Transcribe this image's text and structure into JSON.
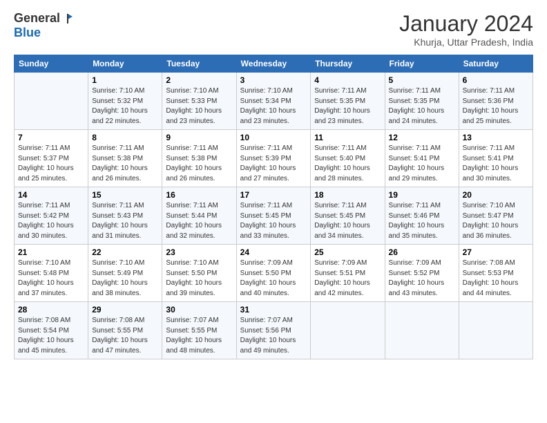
{
  "header": {
    "logo_general": "General",
    "logo_blue": "Blue",
    "title": "January 2024",
    "location": "Khurja, Uttar Pradesh, India"
  },
  "days_of_week": [
    "Sunday",
    "Monday",
    "Tuesday",
    "Wednesday",
    "Thursday",
    "Friday",
    "Saturday"
  ],
  "weeks": [
    [
      {
        "day": "",
        "info": ""
      },
      {
        "day": "1",
        "info": "Sunrise: 7:10 AM\nSunset: 5:32 PM\nDaylight: 10 hours\nand 22 minutes."
      },
      {
        "day": "2",
        "info": "Sunrise: 7:10 AM\nSunset: 5:33 PM\nDaylight: 10 hours\nand 23 minutes."
      },
      {
        "day": "3",
        "info": "Sunrise: 7:10 AM\nSunset: 5:34 PM\nDaylight: 10 hours\nand 23 minutes."
      },
      {
        "day": "4",
        "info": "Sunrise: 7:11 AM\nSunset: 5:35 PM\nDaylight: 10 hours\nand 23 minutes."
      },
      {
        "day": "5",
        "info": "Sunrise: 7:11 AM\nSunset: 5:35 PM\nDaylight: 10 hours\nand 24 minutes."
      },
      {
        "day": "6",
        "info": "Sunrise: 7:11 AM\nSunset: 5:36 PM\nDaylight: 10 hours\nand 25 minutes."
      }
    ],
    [
      {
        "day": "7",
        "info": "Sunrise: 7:11 AM\nSunset: 5:37 PM\nDaylight: 10 hours\nand 25 minutes."
      },
      {
        "day": "8",
        "info": "Sunrise: 7:11 AM\nSunset: 5:38 PM\nDaylight: 10 hours\nand 26 minutes."
      },
      {
        "day": "9",
        "info": "Sunrise: 7:11 AM\nSunset: 5:38 PM\nDaylight: 10 hours\nand 26 minutes."
      },
      {
        "day": "10",
        "info": "Sunrise: 7:11 AM\nSunset: 5:39 PM\nDaylight: 10 hours\nand 27 minutes."
      },
      {
        "day": "11",
        "info": "Sunrise: 7:11 AM\nSunset: 5:40 PM\nDaylight: 10 hours\nand 28 minutes."
      },
      {
        "day": "12",
        "info": "Sunrise: 7:11 AM\nSunset: 5:41 PM\nDaylight: 10 hours\nand 29 minutes."
      },
      {
        "day": "13",
        "info": "Sunrise: 7:11 AM\nSunset: 5:41 PM\nDaylight: 10 hours\nand 30 minutes."
      }
    ],
    [
      {
        "day": "14",
        "info": "Sunrise: 7:11 AM\nSunset: 5:42 PM\nDaylight: 10 hours\nand 30 minutes."
      },
      {
        "day": "15",
        "info": "Sunrise: 7:11 AM\nSunset: 5:43 PM\nDaylight: 10 hours\nand 31 minutes."
      },
      {
        "day": "16",
        "info": "Sunrise: 7:11 AM\nSunset: 5:44 PM\nDaylight: 10 hours\nand 32 minutes."
      },
      {
        "day": "17",
        "info": "Sunrise: 7:11 AM\nSunset: 5:45 PM\nDaylight: 10 hours\nand 33 minutes."
      },
      {
        "day": "18",
        "info": "Sunrise: 7:11 AM\nSunset: 5:45 PM\nDaylight: 10 hours\nand 34 minutes."
      },
      {
        "day": "19",
        "info": "Sunrise: 7:11 AM\nSunset: 5:46 PM\nDaylight: 10 hours\nand 35 minutes."
      },
      {
        "day": "20",
        "info": "Sunrise: 7:10 AM\nSunset: 5:47 PM\nDaylight: 10 hours\nand 36 minutes."
      }
    ],
    [
      {
        "day": "21",
        "info": "Sunrise: 7:10 AM\nSunset: 5:48 PM\nDaylight: 10 hours\nand 37 minutes."
      },
      {
        "day": "22",
        "info": "Sunrise: 7:10 AM\nSunset: 5:49 PM\nDaylight: 10 hours\nand 38 minutes."
      },
      {
        "day": "23",
        "info": "Sunrise: 7:10 AM\nSunset: 5:50 PM\nDaylight: 10 hours\nand 39 minutes."
      },
      {
        "day": "24",
        "info": "Sunrise: 7:09 AM\nSunset: 5:50 PM\nDaylight: 10 hours\nand 40 minutes."
      },
      {
        "day": "25",
        "info": "Sunrise: 7:09 AM\nSunset: 5:51 PM\nDaylight: 10 hours\nand 42 minutes."
      },
      {
        "day": "26",
        "info": "Sunrise: 7:09 AM\nSunset: 5:52 PM\nDaylight: 10 hours\nand 43 minutes."
      },
      {
        "day": "27",
        "info": "Sunrise: 7:08 AM\nSunset: 5:53 PM\nDaylight: 10 hours\nand 44 minutes."
      }
    ],
    [
      {
        "day": "28",
        "info": "Sunrise: 7:08 AM\nSunset: 5:54 PM\nDaylight: 10 hours\nand 45 minutes."
      },
      {
        "day": "29",
        "info": "Sunrise: 7:08 AM\nSunset: 5:55 PM\nDaylight: 10 hours\nand 47 minutes."
      },
      {
        "day": "30",
        "info": "Sunrise: 7:07 AM\nSunset: 5:55 PM\nDaylight: 10 hours\nand 48 minutes."
      },
      {
        "day": "31",
        "info": "Sunrise: 7:07 AM\nSunset: 5:56 PM\nDaylight: 10 hours\nand 49 minutes."
      },
      {
        "day": "",
        "info": ""
      },
      {
        "day": "",
        "info": ""
      },
      {
        "day": "",
        "info": ""
      }
    ]
  ]
}
